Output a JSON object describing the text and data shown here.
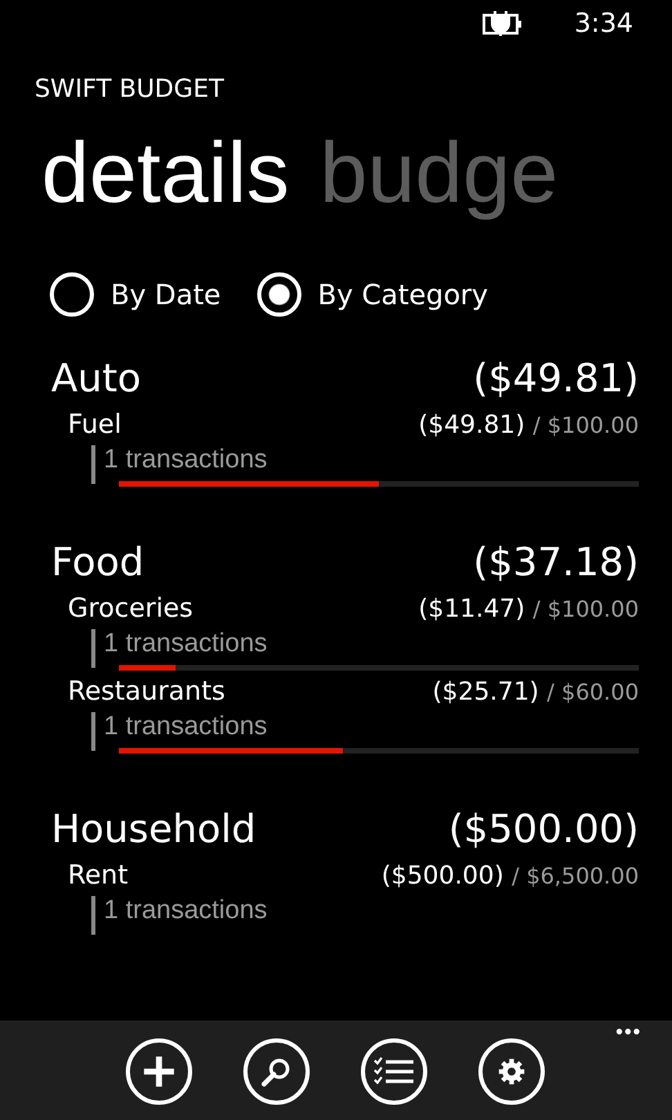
{
  "status_bar": {
    "time": "3:34"
  },
  "app_title": "SWIFT BUDGET",
  "pivot": [
    {
      "label": "details",
      "selected": true
    },
    {
      "label": "budge",
      "selected": false
    }
  ],
  "view_options": [
    {
      "label": "By Date",
      "selected": false
    },
    {
      "label": "By Category",
      "selected": true
    }
  ],
  "groups": [
    {
      "name": "Auto",
      "total": "($49.81)",
      "items": [
        {
          "name": "Fuel",
          "spent": "($49.81)",
          "budget": "/ $100.00",
          "transactions": "1 transactions",
          "level": 0.5
        }
      ]
    },
    {
      "name": "Food",
      "total": "($37.18)",
      "items": [
        {
          "name": "Groceries",
          "spent": "($11.47)",
          "budget": "/ $100.00",
          "transactions": "1 transactions",
          "level": 0.11
        },
        {
          "name": "Restaurants",
          "spent": "($25.71)",
          "budget": "/ $60.00",
          "transactions": "1 transactions",
          "level": 0.43
        }
      ]
    },
    {
      "name": "Household",
      "total": "($500.00)",
      "items": [
        {
          "name": "Rent",
          "spent": "($500.00)",
          "budget": "/ $6,500.00",
          "transactions": "1 transactions"
        }
      ]
    }
  ],
  "app_bar": {
    "buttons": [
      {
        "kind": "add"
      },
      {
        "kind": "search"
      },
      {
        "kind": "list"
      },
      {
        "kind": "settings"
      }
    ],
    "more": "•••"
  }
}
